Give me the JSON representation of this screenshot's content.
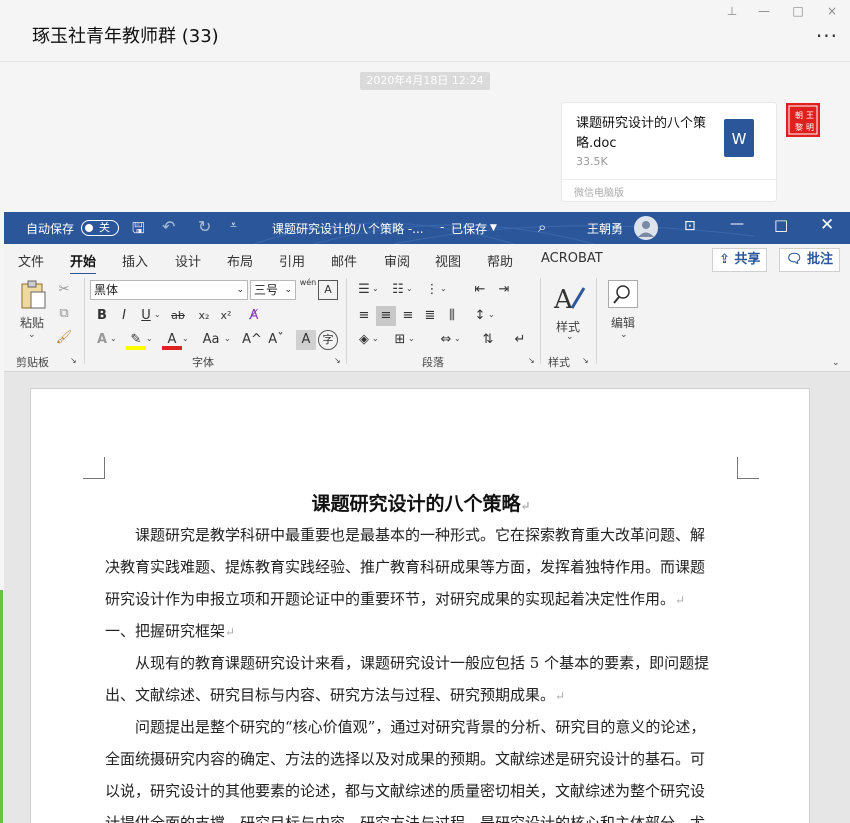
{
  "chat": {
    "title": "琢玉社青年教师群 (33)",
    "window_controls": [
      "⊥",
      "—",
      "□",
      "×"
    ],
    "more": "···",
    "timestamp": "2020年4月18日 12:24",
    "file": {
      "name": "课题研究设计的八个策略.doc",
      "size": "33.5K",
      "source": "微信电脑版",
      "icon_letter": "W"
    },
    "avatar_text": "王朝 黎明"
  },
  "word": {
    "autosave_label": "自动保存",
    "autosave_state": "关",
    "doc_title": "课题研究设计的八个策略 -...",
    "save_status": "已保存",
    "user_name": "王朝勇",
    "tabs": [
      "文件",
      "开始",
      "插入",
      "设计",
      "布局",
      "引用",
      "邮件",
      "审阅",
      "视图",
      "帮助",
      "ACROBAT"
    ],
    "share_label": "共享",
    "comment_label": "批注",
    "ribbon": {
      "paste_label": "粘贴",
      "clipboard_label": "剪贴板",
      "font_name": "黑体",
      "font_size": "三号",
      "font_label": "字体",
      "paragraph_label": "段落",
      "styles_btn": "样式",
      "styles_label": "样式",
      "edit_btn": "编辑",
      "bold": "B",
      "italic": "I",
      "underline": "U",
      "strike": "ab",
      "sub": "x₂",
      "super": "x²",
      "change_case": "Aa",
      "grow": "A^",
      "shrink": "Aˇ",
      "wen": "wén"
    },
    "document": {
      "title": "课题研究设计的八个策略",
      "paragraphs": [
        "课题研究是教学科研中最重要也是最基本的一种形式。它在探索教育重大改革问题、解",
        "决教育实践难题、提炼教育实践经验、推广教育科研成果等方面，发挥着独特作用。而课题",
        "研究设计作为申报立项和开题论证中的重要环节，对研究成果的实现起着决定性作用。",
        "一、把握研究框架",
        "从现有的教育课题研究设计来看，课题研究设计一般应包括 5 个基本的要素，即问题提",
        "出、文献综述、研究目标与内容、研究方法与过程、研究预期成果。",
        "问题提出是整个研究的“核心价值观”，通过对研究背景的分析、研究目的意义的论述，",
        "全面统摄研究内容的确定、方法的选择以及对成果的预期。文献综述是研究设计的基石。可",
        "以说，研究设计的其他要素的论述，都与文献综述的质量密切相关，文献综述为整个研究设",
        "计提供全面的支撑。研究目标与内容、研究方法与过程，是研究设计的核心和主体部分，尤"
      ]
    }
  },
  "colors": {
    "word_blue": "#2b579a",
    "wechat_green": "#6ebf4a",
    "avatar_red": "#e0201e"
  }
}
